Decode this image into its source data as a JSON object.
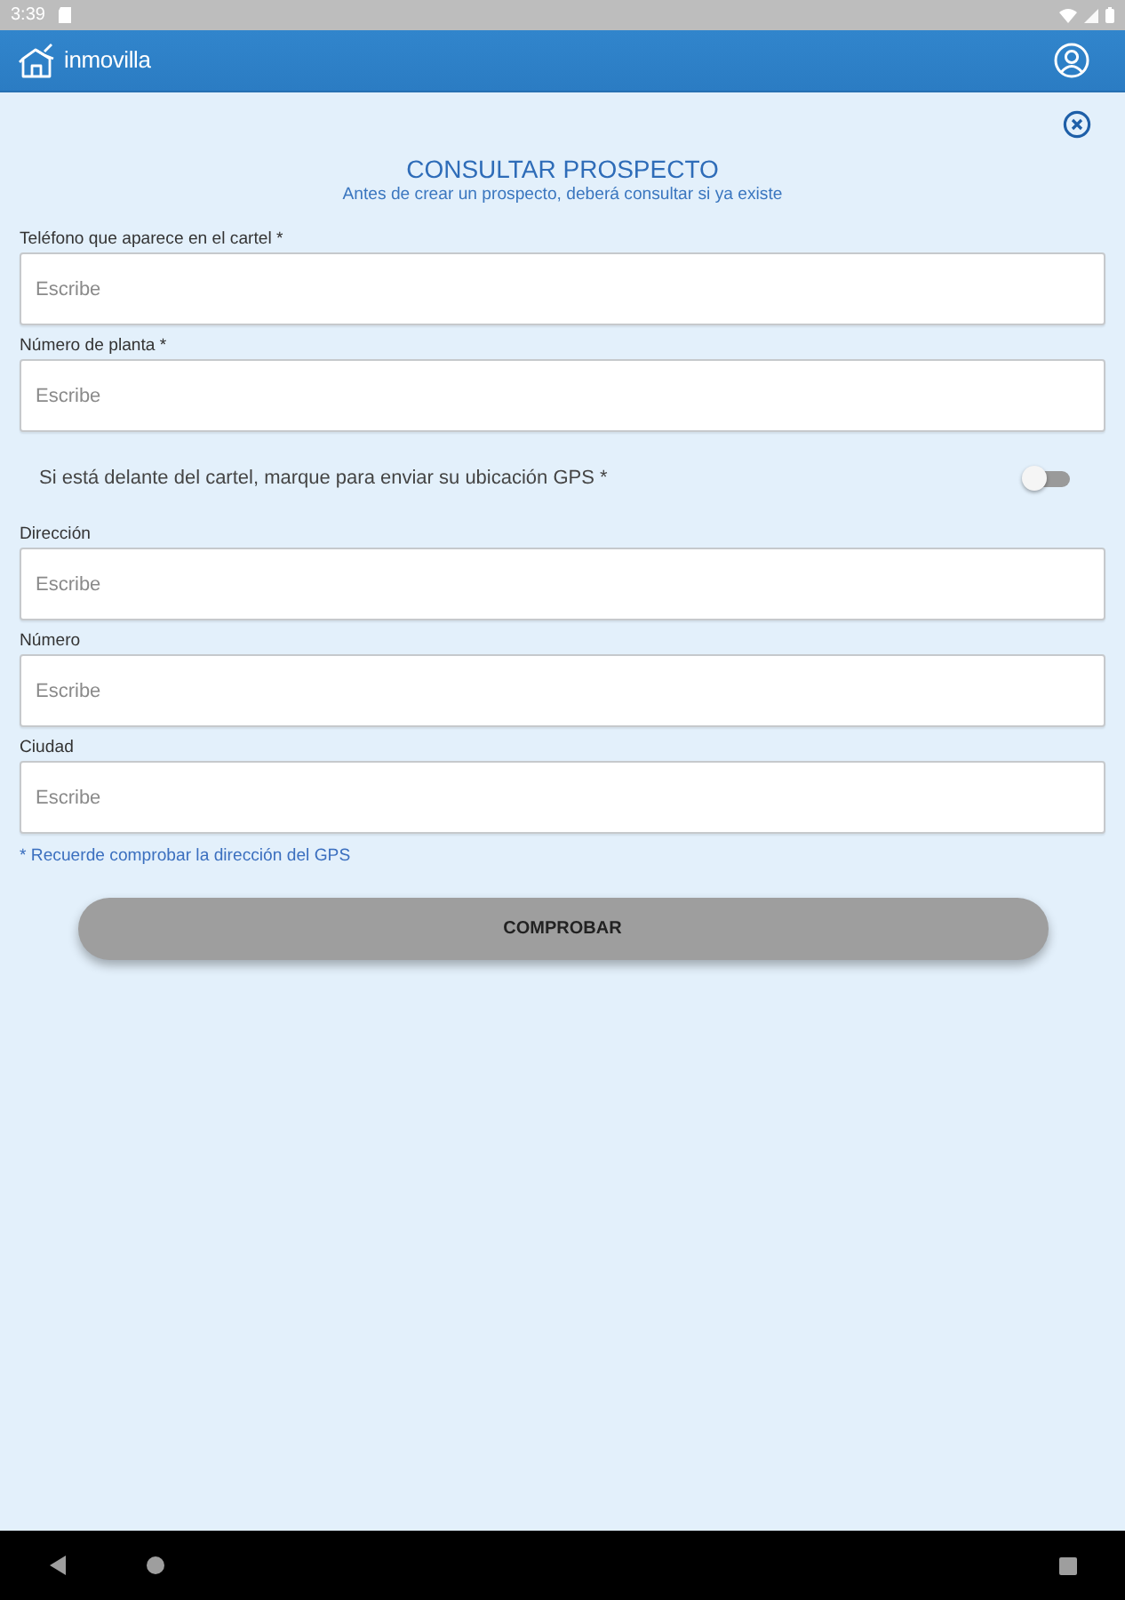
{
  "status_bar": {
    "time": "3:39"
  },
  "app_bar": {
    "brand": "inmovilla"
  },
  "form": {
    "title": "CONSULTAR PROSPECTO",
    "subtitle": "Antes de crear un prospecto, deberá consultar si ya existe",
    "fields": [
      {
        "kind": "input",
        "label": "Teléfono que aparece en el cartel *",
        "placeholder": "Escribe"
      },
      {
        "kind": "input",
        "label": "Número de planta *",
        "placeholder": "Escribe"
      },
      {
        "kind": "switch",
        "label": "Si está delante del cartel, marque para enviar su ubicación GPS *",
        "on": false
      },
      {
        "kind": "input",
        "label": "Dirección",
        "placeholder": "Escribe"
      },
      {
        "kind": "input",
        "label": "Número",
        "placeholder": "Escribe"
      },
      {
        "kind": "input",
        "label": "Ciudad",
        "placeholder": "Escribe"
      }
    ],
    "note": "* Recuerde comprobar la dirección del GPS",
    "submit": "COMPROBAR"
  }
}
